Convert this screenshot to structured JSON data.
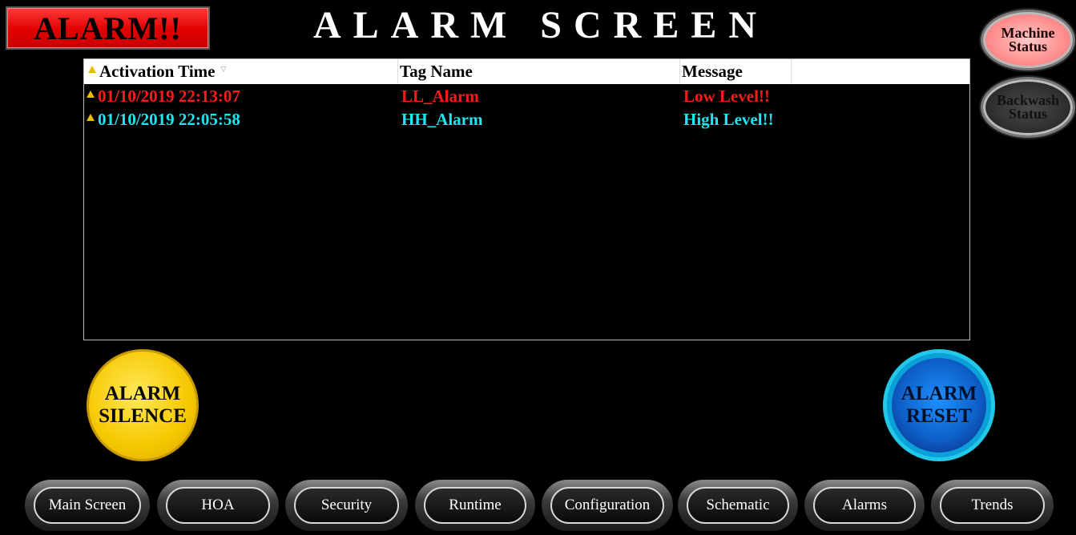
{
  "banner": {
    "label": "ALARM!!",
    "color": "#ff0000"
  },
  "title": "ALARM SCREEN",
  "status_buttons": {
    "machine": {
      "line1": "Machine",
      "line2": "Status",
      "color": "#ff9a9a"
    },
    "backwash": {
      "line1": "Backwash",
      "line2": "Status",
      "color": "#2a2a2a"
    }
  },
  "table": {
    "columns": {
      "time": "Activation Time",
      "tag": "Tag Name",
      "message": "Message"
    },
    "rows": [
      {
        "time": "01/10/2019 22:13:07",
        "tag": "LL_Alarm",
        "message": "Low Level!!",
        "color": "#ff1a1a",
        "icon": "warning-icon"
      },
      {
        "time": "01/10/2019 22:05:58",
        "tag": "HH_Alarm",
        "message": "High Level!!",
        "color": "#1ee6f0",
        "icon": "warning-icon"
      }
    ]
  },
  "actions": {
    "silence": {
      "line1": "ALARM",
      "line2": "SILENCE",
      "color": "#f6c800"
    },
    "reset": {
      "line1": "ALARM",
      "line2": "RESET",
      "color": "#0e60c8"
    }
  },
  "nav": [
    {
      "label": "Main Screen"
    },
    {
      "label": "HOA"
    },
    {
      "label": "Security"
    },
    {
      "label": "Runtime"
    },
    {
      "label": "Configuration"
    },
    {
      "label": "Schematic"
    },
    {
      "label": "Alarms"
    },
    {
      "label": "Trends"
    }
  ]
}
